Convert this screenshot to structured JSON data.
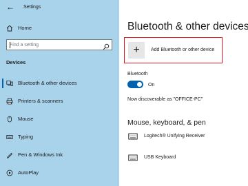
{
  "window": {
    "title": "Settings"
  },
  "nav": {
    "home_label": "Home",
    "search_placeholder": "Find a setting",
    "section_title": "Devices",
    "items": [
      {
        "label": "Bluetooth & other devices",
        "icon": "bluetooth-devices-icon",
        "selected": true
      },
      {
        "label": "Printers & scanners",
        "icon": "printer-icon",
        "selected": false
      },
      {
        "label": "Mouse",
        "icon": "mouse-icon",
        "selected": false
      },
      {
        "label": "Typing",
        "icon": "keyboard-icon",
        "selected": false
      },
      {
        "label": "Pen & Windows Ink",
        "icon": "pen-icon",
        "selected": false
      },
      {
        "label": "AutoPlay",
        "icon": "autoplay-icon",
        "selected": false
      }
    ]
  },
  "main": {
    "title": "Bluetooth & other devices",
    "add_device_label": "Add Bluetooth or other device",
    "bluetooth_label": "Bluetooth",
    "bluetooth_state": "On",
    "discoverable_text": "Now discoverable as \"OFFICE-PC\"",
    "section_heading": "Mouse, keyboard, & pen",
    "devices": [
      {
        "name": "Logitech® Unifying Receiver",
        "icon": "keyboard-icon"
      },
      {
        "name": "USB Keyboard",
        "icon": "keyboard-icon"
      }
    ]
  },
  "colors": {
    "sidebar_bg": "#a9d2eb",
    "accent": "#0063b1",
    "highlight_border": "#e4151d"
  }
}
